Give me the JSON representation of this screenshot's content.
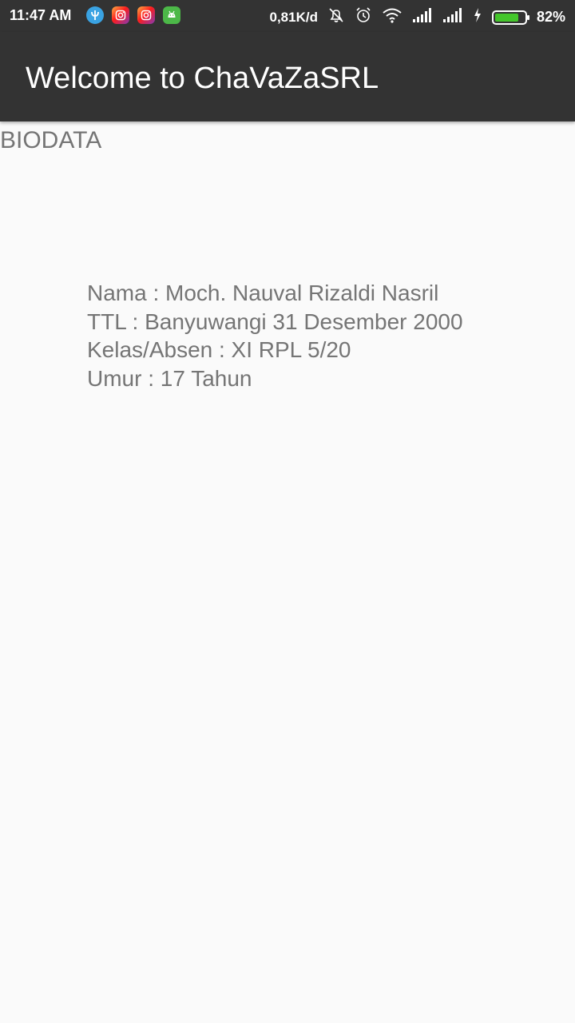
{
  "status_bar": {
    "time": "11:47 AM",
    "network_speed": "0,81K/d",
    "battery_percent": "82%",
    "battery_level": 0.82,
    "notification_icons": [
      "psiphon-icon",
      "instagram-icon",
      "instagram-icon",
      "android-icon"
    ],
    "system_icons": [
      "mute-bell-icon",
      "alarm-icon",
      "wifi-icon",
      "signal-icon",
      "signal-icon",
      "charging-icon",
      "battery-icon"
    ]
  },
  "app_bar": {
    "title": "Welcome to ChaVaZaSRL"
  },
  "content": {
    "heading": "BIODATA",
    "lines": [
      "Nama : Moch. Nauval Rizaldi Nasril",
      "TTL : Banyuwangi 31 Desember 2000",
      "Kelas/Absen : XI RPL 5/20",
      "Umur : 17 Tahun"
    ]
  },
  "colors": {
    "bar_background": "#333333",
    "page_background": "#fafafa",
    "text_gray": "#757575",
    "battery_green": "#44c62b"
  }
}
